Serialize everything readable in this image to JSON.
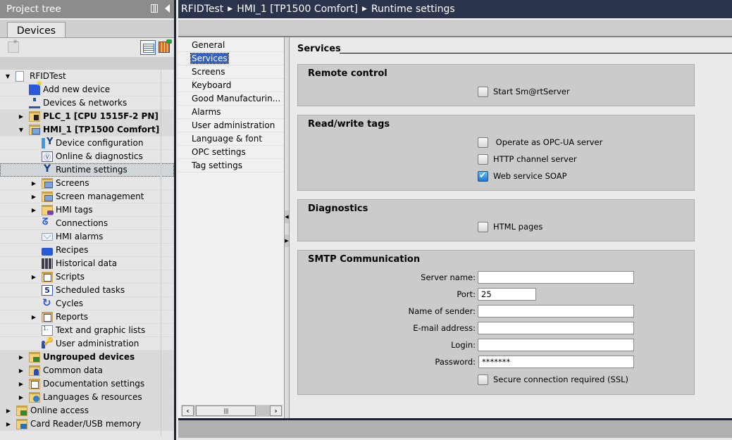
{
  "project_tree": {
    "title": "Project tree",
    "tab": "Devices",
    "items": [
      {
        "label": "RFIDTest",
        "expanded": true
      },
      {
        "label": "Add new device"
      },
      {
        "label": "Devices & networks"
      },
      {
        "label": "PLC_1 [CPU 1515F-2 PN]",
        "expanded": false
      },
      {
        "label": "HMI_1 [TP1500 Comfort]",
        "expanded": true
      },
      {
        "label": "Device configuration"
      },
      {
        "label": "Online & diagnostics"
      },
      {
        "label": "Runtime settings",
        "selected": true
      },
      {
        "label": "Screens",
        "expanded": false
      },
      {
        "label": "Screen management",
        "expanded": false
      },
      {
        "label": "HMI tags",
        "expanded": false
      },
      {
        "label": "Connections"
      },
      {
        "label": "HMI alarms"
      },
      {
        "label": "Recipes"
      },
      {
        "label": "Historical data"
      },
      {
        "label": "Scripts",
        "expanded": false
      },
      {
        "label": "Scheduled tasks"
      },
      {
        "label": "Cycles"
      },
      {
        "label": "Reports",
        "expanded": false
      },
      {
        "label": "Text and graphic lists"
      },
      {
        "label": "User administration"
      },
      {
        "label": "Ungrouped devices",
        "expanded": false
      },
      {
        "label": "Common data",
        "expanded": false
      },
      {
        "label": "Documentation settings",
        "expanded": false
      },
      {
        "label": "Languages & resources",
        "expanded": false
      },
      {
        "label": "Online access",
        "expanded": false
      },
      {
        "label": "Card Reader/USB memory",
        "expanded": false
      }
    ]
  },
  "breadcrumb": [
    "RFIDTest",
    "HMI_1 [TP1500 Comfort]",
    "Runtime settings"
  ],
  "nav": {
    "items": [
      "General",
      "Services",
      "Screens",
      "Keyboard",
      "Good Manufacturin...",
      "Alarms",
      "User administration",
      "Language & font",
      "OPC settings",
      "Tag settings"
    ],
    "active": "Services"
  },
  "services": {
    "title": "Services",
    "remote_control": {
      "title": "Remote control",
      "options": [
        {
          "label": "Start Sm@rtServer",
          "checked": false
        }
      ]
    },
    "read_write_tags": {
      "title": "Read/write tags",
      "options": [
        {
          "label": " Operate as OPC-UA server",
          "checked": false
        },
        {
          "label": "HTTP channel server",
          "checked": false
        },
        {
          "label": "Web service SOAP",
          "checked": true
        }
      ]
    },
    "diagnostics": {
      "title": "Diagnostics",
      "options": [
        {
          "label": "HTML pages",
          "checked": false
        }
      ]
    },
    "smtp": {
      "title": "SMTP Communication",
      "fields": [
        {
          "label": "Server name:",
          "value": ""
        },
        {
          "label": "Port:",
          "value": "25"
        },
        {
          "label": "Name of sender:",
          "value": ""
        },
        {
          "label": "E-mail address:",
          "value": ""
        },
        {
          "label": "Login:",
          "value": ""
        },
        {
          "label": "Password:",
          "value": "*******"
        }
      ],
      "ssl": {
        "label": "Secure connection required (SSL)",
        "checked": false
      }
    }
  },
  "colors": {
    "title_bar": "#2c334d",
    "tree_header": "#8c8c8c",
    "selection": "#3162c8",
    "group_bg": "#cbcbcb"
  }
}
